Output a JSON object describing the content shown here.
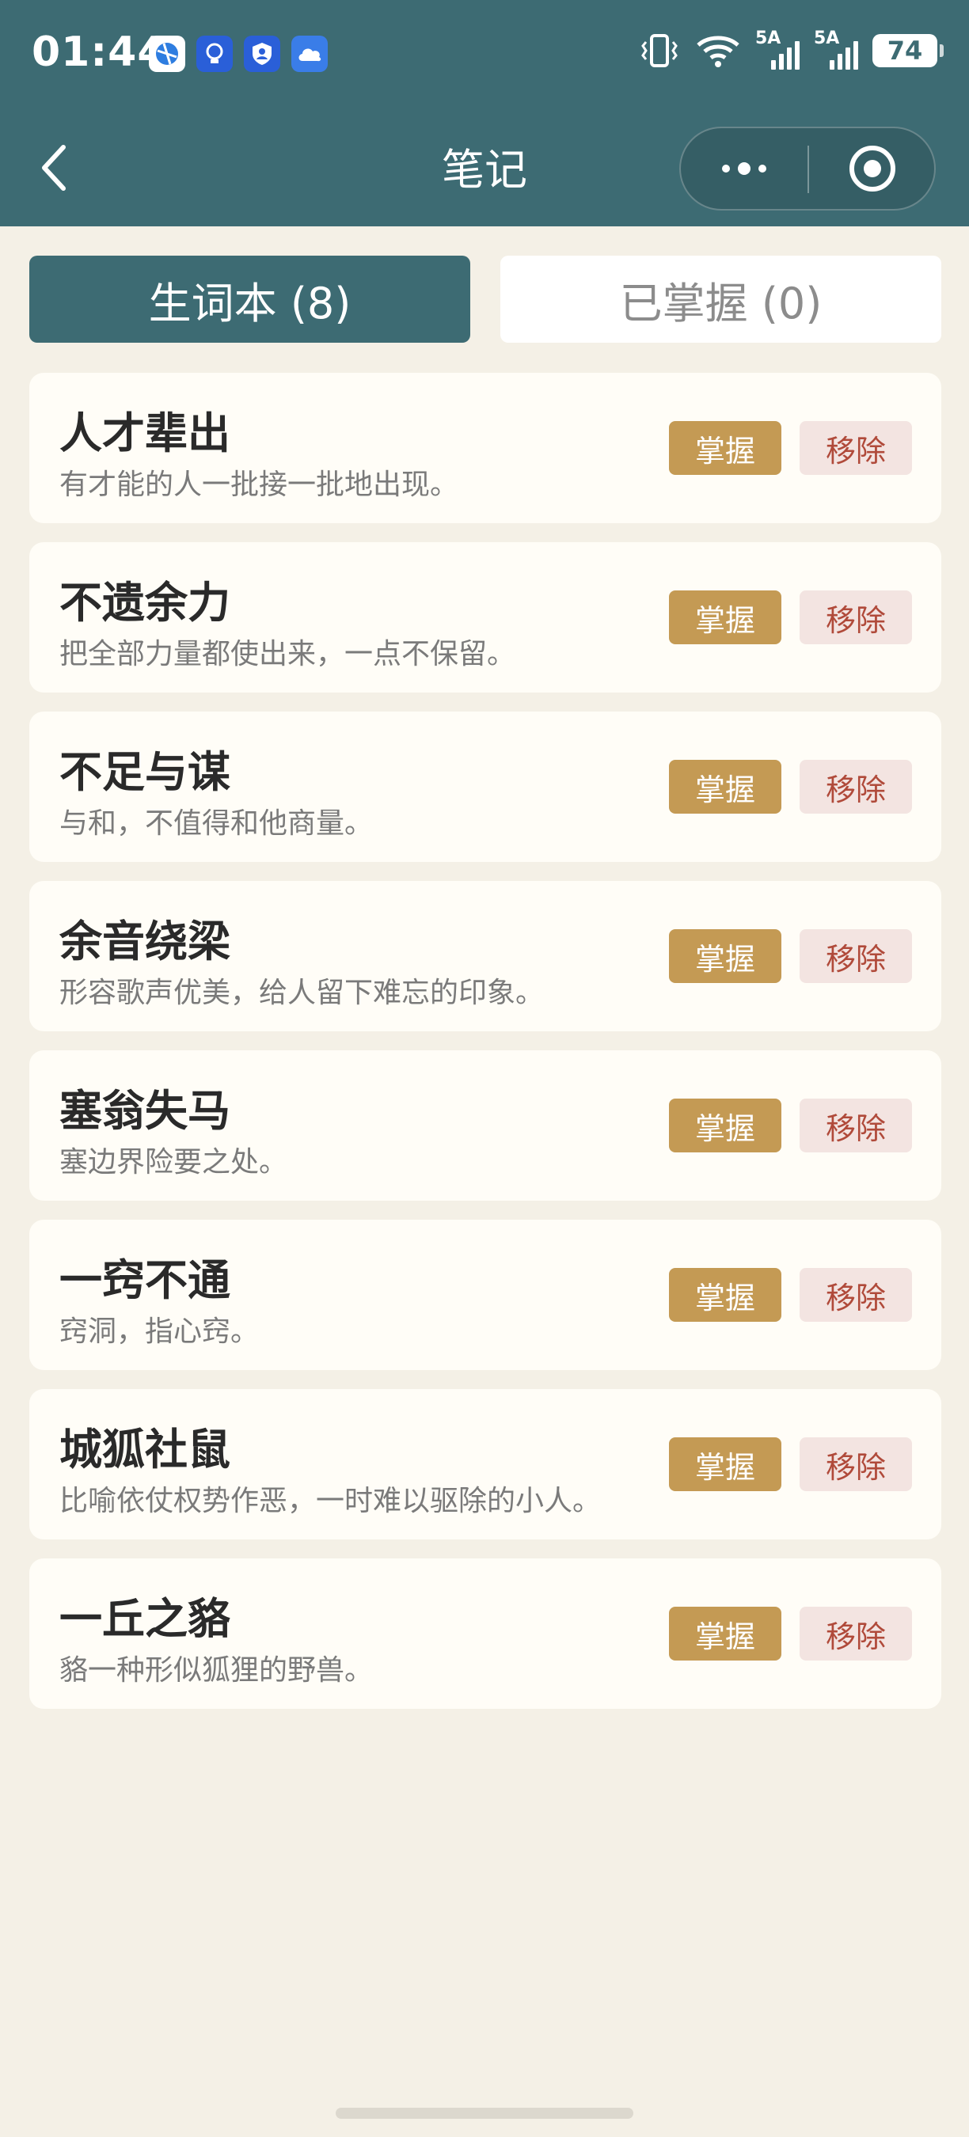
{
  "status_bar": {
    "time": "01:44",
    "battery": "74",
    "network_1": "5A",
    "network_2": "5A",
    "notification_icons": [
      "browser-icon",
      "bulb-icon",
      "shield-icon",
      "cloud-icon"
    ],
    "colors": {
      "icon_bg": "#2e6fe0"
    }
  },
  "nav": {
    "title": "笔记"
  },
  "tabs": [
    {
      "label": "生词本 (8)",
      "active": true
    },
    {
      "label": "已掌握 (0)",
      "active": false
    }
  ],
  "actions": {
    "master_label": "掌握",
    "remove_label": "移除"
  },
  "words": [
    {
      "word": "人才辈出",
      "meaning": "有才能的人一批接一批地出现。"
    },
    {
      "word": "不遗余力",
      "meaning": "把全部力量都使出来，一点不保留。"
    },
    {
      "word": "不足与谋",
      "meaning": "与和，不值得和他商量。"
    },
    {
      "word": "余音绕梁",
      "meaning": "形容歌声优美，给人留下难忘的印象。"
    },
    {
      "word": "塞翁失马",
      "meaning": "塞边界险要之处。"
    },
    {
      "word": "一窍不通",
      "meaning": "窍洞，指心窍。"
    },
    {
      "word": "城狐社鼠",
      "meaning": "比喻依仗权势作恶，一时难以驱除的小人。"
    },
    {
      "word": "一丘之貉",
      "meaning": "貉一种形似狐狸的野兽。"
    }
  ],
  "colors": {
    "primary": "#3d6b73",
    "background": "#f4f0e6",
    "card": "#fffdf7",
    "master_button": "#c49a54",
    "remove_button_bg": "#f3e4e1",
    "remove_button_text": "#b04a3a"
  }
}
